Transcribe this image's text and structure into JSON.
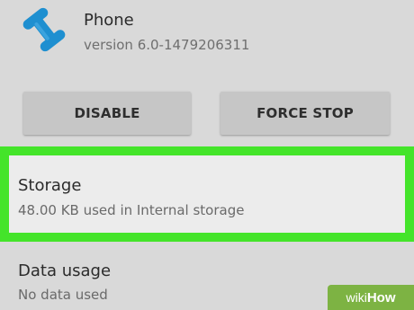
{
  "app": {
    "name": "Phone",
    "version": "version 6.0-1479206311",
    "icon": "phone-handset-icon"
  },
  "buttons": {
    "disable_label": "DISABLE",
    "force_stop_label": "FORCE STOP"
  },
  "storage": {
    "title": "Storage",
    "subtitle": "48.00 KB used in Internal storage",
    "highlight_color": "#44e42a"
  },
  "data_usage": {
    "title": "Data usage",
    "subtitle": "No data used"
  },
  "watermark": {
    "brand_prefix": "wiki",
    "brand_suffix": "How",
    "color": "#7db343"
  }
}
